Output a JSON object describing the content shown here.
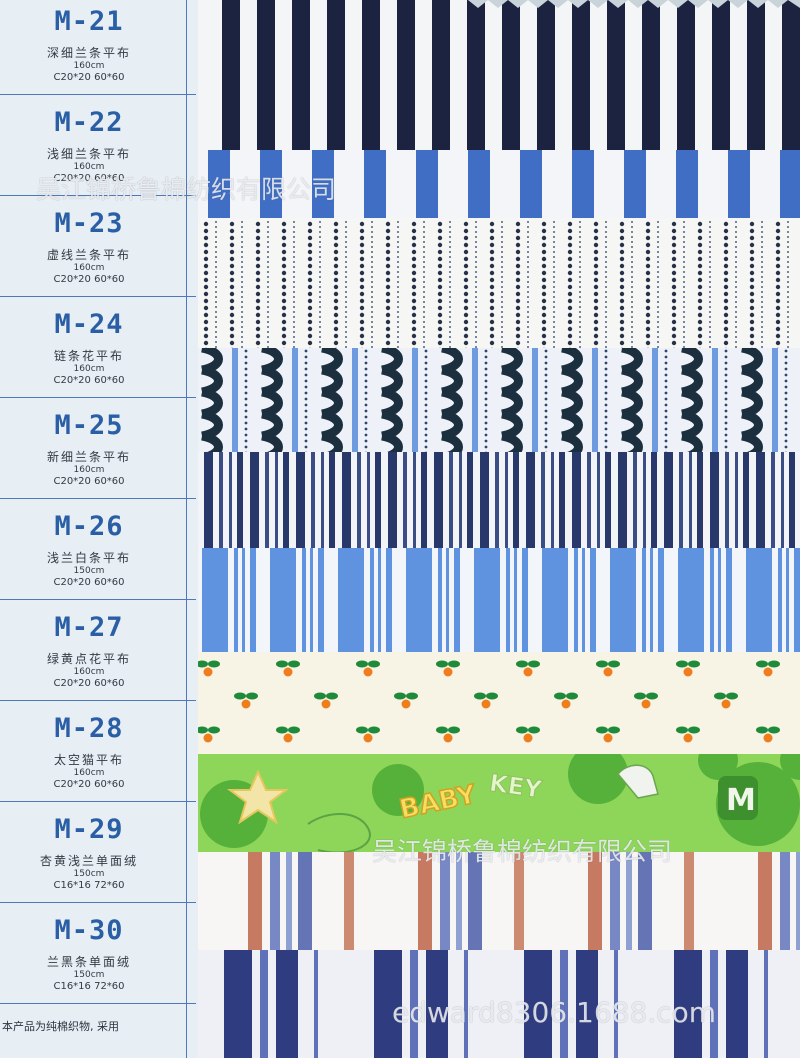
{
  "entries": [
    {
      "code": "M-21",
      "name": "深细兰条平布",
      "width": "160cm",
      "yarn": "C20*20  60*60"
    },
    {
      "code": "M-22",
      "name": "浅细兰条平布",
      "width": "160cm",
      "yarn": "C20*20  60*60"
    },
    {
      "code": "M-23",
      "name": "虚线兰条平布",
      "width": "160cm",
      "yarn": "C20*20  60*60"
    },
    {
      "code": "M-24",
      "name": "链条花平布",
      "width": "160cm",
      "yarn": "C20*20  60*60"
    },
    {
      "code": "M-25",
      "name": "新细兰条平布",
      "width": "160cm",
      "yarn": "C20*20  60*60"
    },
    {
      "code": "M-26",
      "name": "浅兰白条平布",
      "width": "150cm",
      "yarn": "C20*20  60*60"
    },
    {
      "code": "M-27",
      "name": "绿黄点花平布",
      "width": "160cm",
      "yarn": "C20*20  60*60"
    },
    {
      "code": "M-28",
      "name": "太空猫平布",
      "width": "160cm",
      "yarn": "C20*20  60*60"
    },
    {
      "code": "M-29",
      "name": "杏黄浅兰单面绒",
      "width": "150cm",
      "yarn": "C16*16  72*60"
    },
    {
      "code": "M-30",
      "name": "兰黑条单面绒",
      "width": "150cm",
      "yarn": "C16*16  72*60"
    }
  ],
  "footer": "本产品为纯棉织物, 采用",
  "watermarks": {
    "company_top": "吴江锦桥鲁棉纺织有限公司",
    "company_bottom": "吴江锦桥鲁棉纺织有限公司",
    "site": "edward8306.1688.com"
  },
  "swatch_print": {
    "baby_text": "BABY",
    "mickey_text": "KEY",
    "m_letter": "M"
  },
  "colors": {
    "card_bg": "#e7eef4",
    "code_blue": "#2a5fa6",
    "navy": "#1b2340",
    "medium_blue": "#3f6ec4",
    "light_blue": "#6e9be0",
    "cream": "#f7f4e6",
    "green": "#8ed65a",
    "orange": "#ee7d1c",
    "leaf_green": "#1f8a3a",
    "rust": "#c77a62"
  }
}
